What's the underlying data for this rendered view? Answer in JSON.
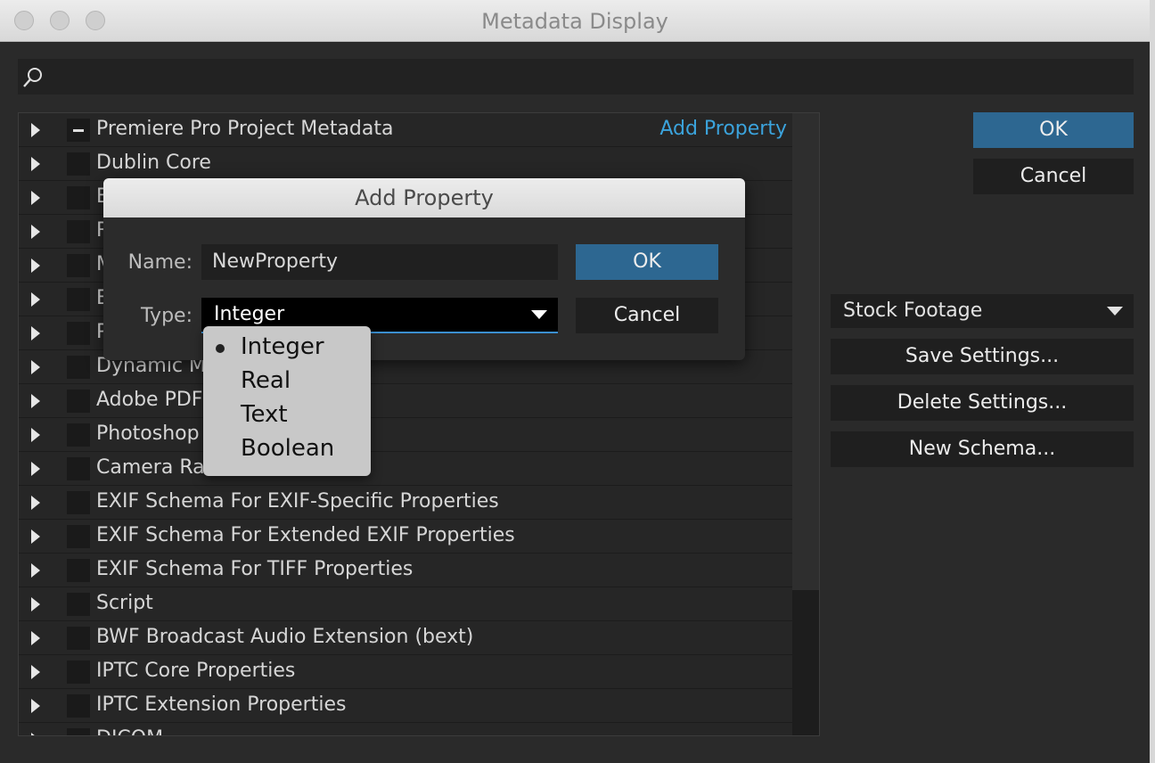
{
  "window": {
    "title": "Metadata Display"
  },
  "search": {
    "placeholder": ""
  },
  "schemas": [
    {
      "label": "Premiere Pro Project Metadata",
      "checked": "partial"
    },
    {
      "label": "Dublin Core"
    },
    {
      "label": "Basic"
    },
    {
      "label": "Rights Management"
    },
    {
      "label": "Media Management"
    },
    {
      "label": "Basic Job Ticket"
    },
    {
      "label": "Paged-Text"
    },
    {
      "label": "Dynamic Media"
    },
    {
      "label": "Adobe PDF"
    },
    {
      "label": "Photoshop"
    },
    {
      "label": "Camera Raw"
    },
    {
      "label": "EXIF Schema For EXIF-Specific Properties"
    },
    {
      "label": "EXIF Schema For Extended EXIF Properties"
    },
    {
      "label": "EXIF Schema For TIFF Properties"
    },
    {
      "label": "Script"
    },
    {
      "label": "BWF Broadcast Audio Extension (bext)"
    },
    {
      "label": "IPTC Core Properties"
    },
    {
      "label": "IPTC Extension Properties"
    },
    {
      "label": "DICOM"
    }
  ],
  "add_property_link": "Add Property",
  "main_buttons": {
    "ok": "OK",
    "cancel": "Cancel"
  },
  "preset": {
    "selected": "Stock Footage"
  },
  "settings_buttons": {
    "save": "Save Settings...",
    "delete": "Delete Settings...",
    "new_schema": "New Schema..."
  },
  "dialog": {
    "title": "Add Property",
    "name_label": "Name:",
    "name_value": "NewProperty",
    "type_label": "Type:",
    "type_value": "Integer",
    "ok": "OK",
    "cancel": "Cancel",
    "type_options": [
      "Integer",
      "Real",
      "Text",
      "Boolean"
    ]
  },
  "colors": {
    "accent_blue": "#2d6791",
    "link_blue": "#3ba3dc",
    "panel": "#2a2a2a"
  },
  "icons": {
    "search": "search-icon",
    "expand": "triangle-right-icon",
    "dropdown": "chevron-down-icon"
  }
}
